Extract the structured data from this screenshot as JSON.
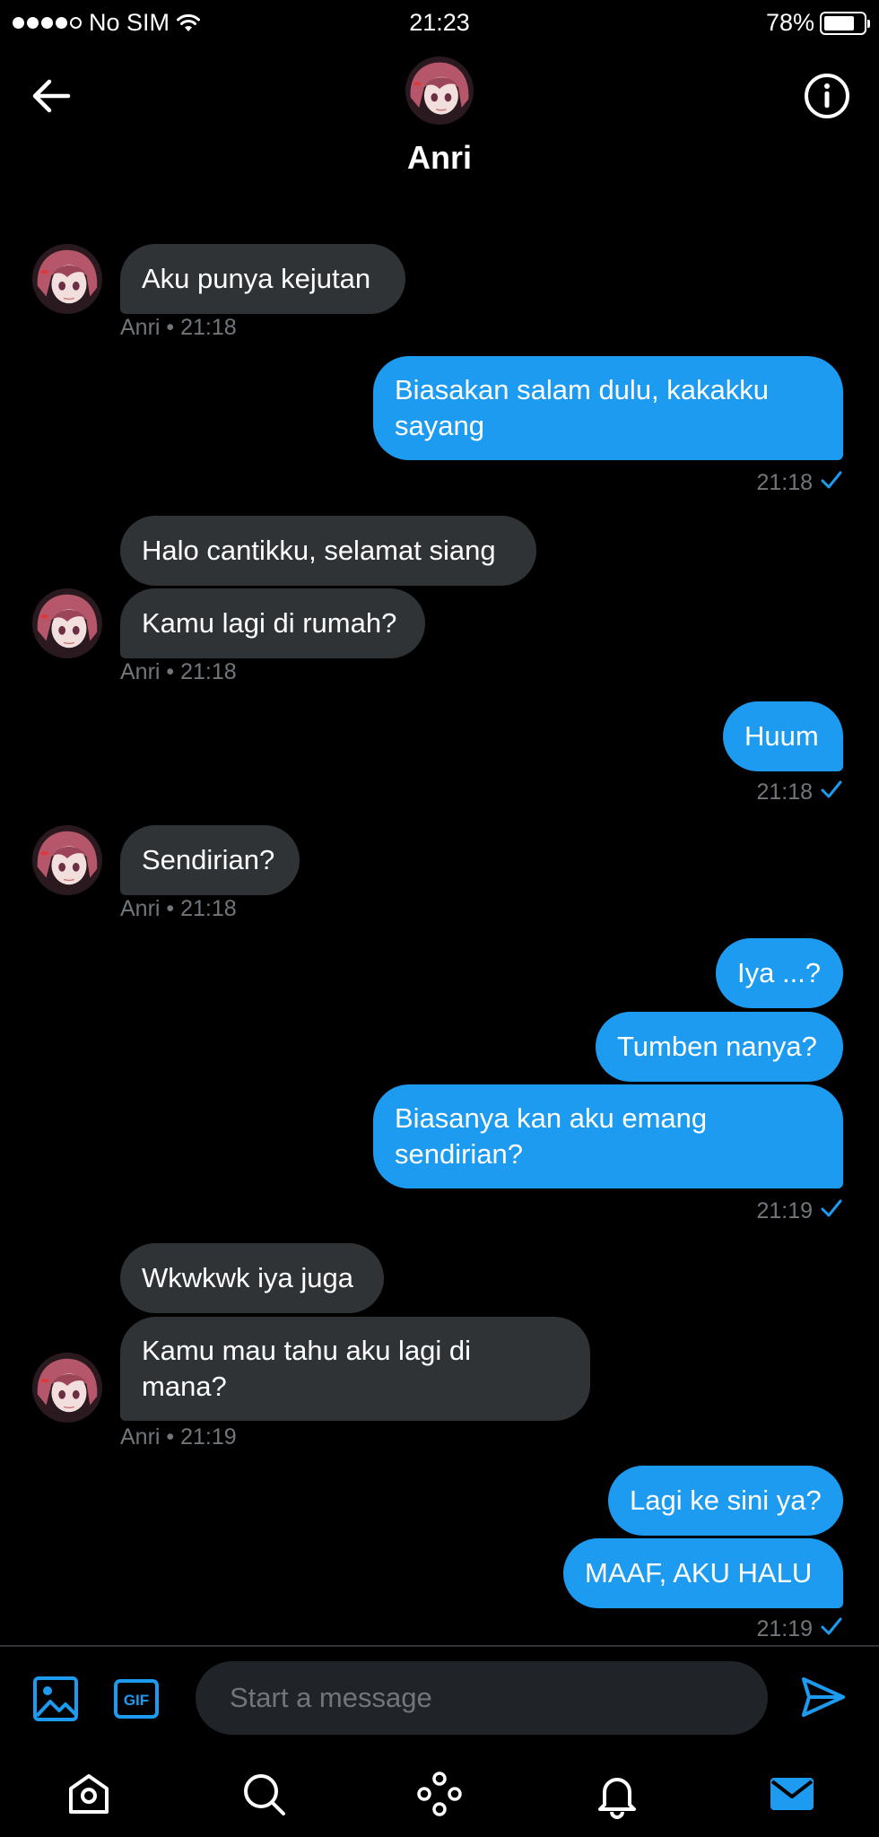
{
  "status_bar": {
    "carrier": "No SIM",
    "time": "21:23",
    "battery": "78%",
    "battery_level": 0.78
  },
  "header": {
    "contact_name": "Anri",
    "back_icon": "arrow-left-icon",
    "info_icon": "info-icon"
  },
  "messages": [
    {
      "side": "in",
      "lines": [
        "Aku punya kejutan"
      ],
      "meta": "Anri • 21:18"
    },
    {
      "side": "out",
      "lines": [
        "Biasakan salam dulu, kakakku",
        "sayang"
      ],
      "meta": "21:18"
    },
    {
      "side": "in",
      "lines": [
        "Halo cantikku, selamat siang"
      ]
    },
    {
      "side": "in",
      "lines": [
        "Kamu lagi di rumah?"
      ],
      "meta": "Anri • 21:18"
    },
    {
      "side": "out",
      "lines": [
        "Huum"
      ],
      "meta": "21:18"
    },
    {
      "side": "in",
      "lines": [
        "Sendirian?"
      ],
      "meta": "Anri • 21:18"
    },
    {
      "side": "out",
      "lines": [
        "Iya ...?"
      ]
    },
    {
      "side": "out",
      "lines": [
        "Tumben nanya?"
      ]
    },
    {
      "side": "out",
      "lines": [
        "Biasanya kan aku emang",
        "sendirian?"
      ],
      "meta": "21:19"
    },
    {
      "side": "in",
      "lines": [
        "Wkwkwk iya juga"
      ]
    },
    {
      "side": "in",
      "lines": [
        "Kamu mau tahu aku lagi di",
        "mana?"
      ],
      "meta": "Anri • 21:19"
    },
    {
      "side": "out",
      "lines": [
        "Lagi ke sini ya?"
      ]
    },
    {
      "side": "out",
      "lines": [
        "MAAF, AKU HALU"
      ],
      "meta": "21:19"
    }
  ],
  "composer": {
    "placeholder": "Start a message",
    "image_icon": "image-icon",
    "gif_label": "GIF",
    "send_icon": "send-icon"
  },
  "nav": {
    "items": [
      "home-icon",
      "search-icon",
      "spaces-icon",
      "notifications-icon",
      "messages-icon"
    ],
    "active": "messages-icon"
  },
  "colors": {
    "accent": "#1d9bf0",
    "incoming_bubble": "#2f3336",
    "meta_text": "#71767b",
    "background": "#000000"
  }
}
